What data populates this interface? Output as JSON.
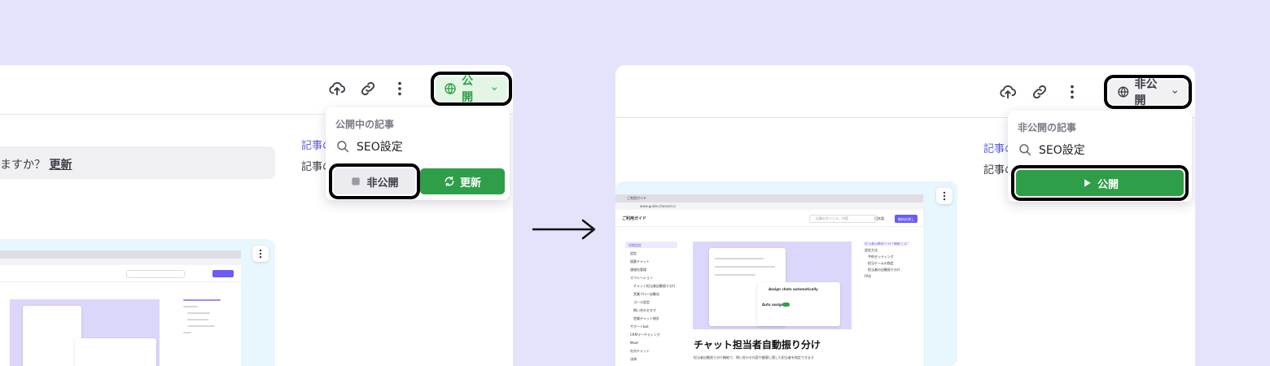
{
  "left": {
    "toolbar": {
      "publish_status_label": "公開"
    },
    "dropdown": {
      "heading": "公開中の記事",
      "seo_label": "SEO設定",
      "unpublish_label": "非公開",
      "update_label": "更新"
    },
    "update_prompt": {
      "text": "ますか？",
      "action": "更新"
    },
    "side_link": "記事の",
    "side_text": "記事の"
  },
  "right": {
    "toolbar": {
      "publish_status_label": "非公開"
    },
    "dropdown": {
      "heading": "非公開の記事",
      "seo_label": "SEO設定",
      "publish_label": "公開"
    },
    "side_link": "記事の",
    "side_text": "記事の",
    "preview": {
      "tab_title": "ご利用ガイド",
      "url": "www.guide.channel.io",
      "site_title": "ご利用ガイド",
      "search_placeholder": "記事のタイトル、内容",
      "language": "日本語",
      "cta": "無料お試し",
      "nav_items": [
        "初期設定",
        "設定",
        "個客チャット",
        "連絡先管理",
        "オペレーション",
        "チャット担当者自動振り分け",
        "営業フロー自動化",
        "ゴール設定",
        "問い合わせタグ",
        "営業チャット統計",
        "サポートbot",
        "CRMマーケティング",
        "Meet",
        "社内チャット",
        "決済"
      ],
      "heading": "チャット担当者自動振り分け",
      "subtext": "担当者自動振り分け機能で、問い合わせ内容や顧客に適した担当者を指定できます",
      "card_title": "Assign chats automatically",
      "card_toggle_label": "Auto assign",
      "toc_items": [
        "担当者自動振り分け機能とは？",
        "設定方法",
        "予約セッティング",
        "担当チームの指定",
        "担当者の自動振り分け",
        "FAQ"
      ]
    }
  },
  "colors": {
    "green": "#2f9e48",
    "accent_link": "#5b5be0",
    "background": "#e4e3fc"
  }
}
